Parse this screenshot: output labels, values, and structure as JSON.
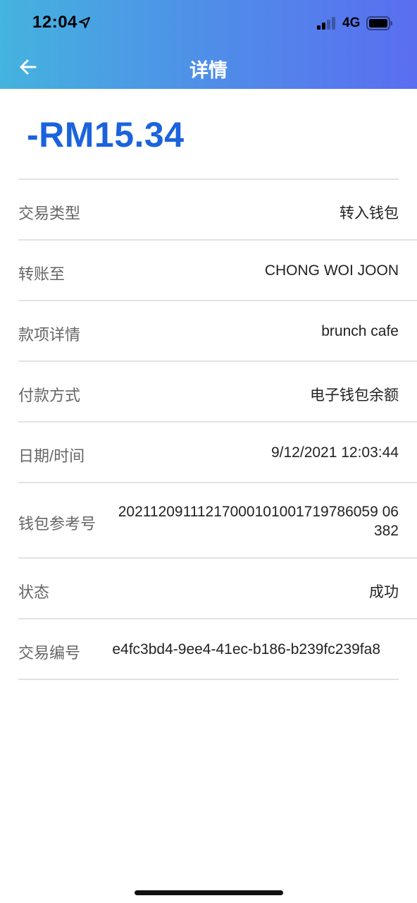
{
  "status_bar": {
    "time": "12:04",
    "network": "4G"
  },
  "header": {
    "title": "详情"
  },
  "transaction": {
    "amount": "-RM15.34",
    "rows": [
      {
        "label": "交易类型",
        "value": "转入钱包"
      },
      {
        "label": "转账至",
        "value": "CHONG WOI JOON"
      },
      {
        "label": "款项详情",
        "value": "brunch cafe"
      },
      {
        "label": "付款方式",
        "value": "电子钱包余额"
      },
      {
        "label": "日期/时间",
        "value": "9/12/2021 12:03:44"
      },
      {
        "label": "钱包参考号",
        "value": "20211209111217000101001719786059 06382"
      },
      {
        "label": "状态",
        "value": "成功"
      },
      {
        "label": "交易编号",
        "value": "e4fc3bd4-9ee4-41ec-b186-b239fc239fa8"
      }
    ]
  },
  "colors": {
    "header_gradient_start": "#44b3de",
    "header_gradient_end": "#5a6ef0",
    "amount": "#1b63dd"
  },
  "icons": {
    "back": "arrow-left-icon",
    "location": "location-arrow-icon",
    "signal": "cellular-signal-icon",
    "battery": "battery-icon"
  }
}
